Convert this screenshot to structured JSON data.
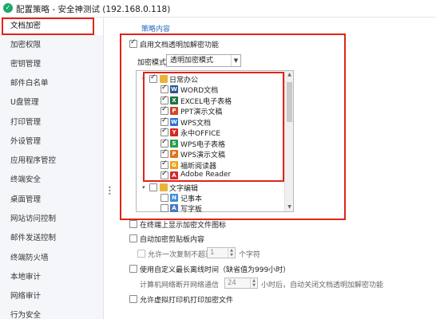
{
  "window": {
    "title": "配置策略 - 安全神测试 (192.168.0.118)",
    "app_icon": "shield-icon"
  },
  "sidebar": {
    "items": [
      {
        "label": "文档加密",
        "active": true
      },
      {
        "label": "加密权限"
      },
      {
        "label": "密钥管理"
      },
      {
        "label": "邮件白名单"
      },
      {
        "label": "U盘管理"
      },
      {
        "label": "打印管理"
      },
      {
        "label": "外设管理"
      },
      {
        "label": "应用程序管控"
      },
      {
        "label": "终端安全"
      },
      {
        "label": "桌面管理"
      },
      {
        "label": "网站访问控制"
      },
      {
        "label": "邮件发送控制"
      },
      {
        "label": "终端防火墙"
      },
      {
        "label": "本地审计"
      },
      {
        "label": "网络审计"
      },
      {
        "label": "行为安全"
      }
    ]
  },
  "policy": {
    "section_title": "策略内容",
    "enable_label": "启用文档透明加解密功能",
    "enable_checked": true,
    "mode_label": "加密模式",
    "mode_value": "透明加密模式",
    "tree": {
      "groups": [
        {
          "label": "日常办公",
          "checked": true,
          "expanded": true,
          "items": [
            {
              "label": "WORD文档",
              "checked": true,
              "icon": "word-icon",
              "icon_color": "#2b5797",
              "icon_glyph": "W"
            },
            {
              "label": "EXCEL电子表格",
              "checked": true,
              "icon": "excel-icon",
              "icon_color": "#1e7145",
              "icon_glyph": "X"
            },
            {
              "label": "PPT演示文稿",
              "checked": true,
              "icon": "ppt-icon",
              "icon_color": "#d24726",
              "icon_glyph": "P"
            },
            {
              "label": "WPS文档",
              "checked": true,
              "icon": "wps-writer-icon",
              "icon_color": "#2f6fd1",
              "icon_glyph": "W"
            },
            {
              "label": "永中OFFICE",
              "checked": true,
              "icon": "yozo-office-icon",
              "icon_color": "#d9261c",
              "icon_glyph": "Y"
            },
            {
              "label": "WPS电子表格",
              "checked": true,
              "icon": "wps-spreadsheet-icon",
              "icon_color": "#2c9a4c",
              "icon_glyph": "S"
            },
            {
              "label": "WPS演示文稿",
              "checked": true,
              "icon": "wps-presentation-icon",
              "icon_color": "#e2721b",
              "icon_glyph": "P"
            },
            {
              "label": "福昕阅读器",
              "checked": true,
              "icon": "foxit-reader-icon",
              "icon_color": "#e8a317",
              "icon_glyph": "G"
            },
            {
              "label": "Adobe Reader",
              "checked": true,
              "icon": "adobe-reader-icon",
              "icon_color": "#d7282f",
              "icon_glyph": "A"
            }
          ]
        },
        {
          "label": "文字编辑",
          "checked": false,
          "expanded": true,
          "items": [
            {
              "label": "记事本",
              "checked": false,
              "icon": "notepad-icon",
              "icon_color": "#3a8fd6",
              "icon_glyph": "N"
            },
            {
              "label": "写字板",
              "checked": false,
              "icon": "wordpad-icon",
              "icon_color": "#4a79c1",
              "icon_glyph": "A"
            }
          ]
        }
      ]
    },
    "show_icon_label": "在终端上显示加密文件图标",
    "auto_clipboard_label": "自动加密剪贴板内容",
    "copy_limit_prefix": "允许一次复制不超过",
    "copy_limit_value": "1",
    "copy_limit_suffix": "个字符",
    "offline_label": "使用自定义最长离线时间（缺省值为999小时）",
    "offline_prefix": "计算机网络断开网络通信",
    "offline_value": "24",
    "offline_suffix": "小时后，自动关闭文档透明加解密功能",
    "virtual_print_label": "允许虚拟打印机打印加密文件"
  },
  "colors": {
    "highlight": "#e2231a",
    "section_title": "#2b6cc4"
  }
}
